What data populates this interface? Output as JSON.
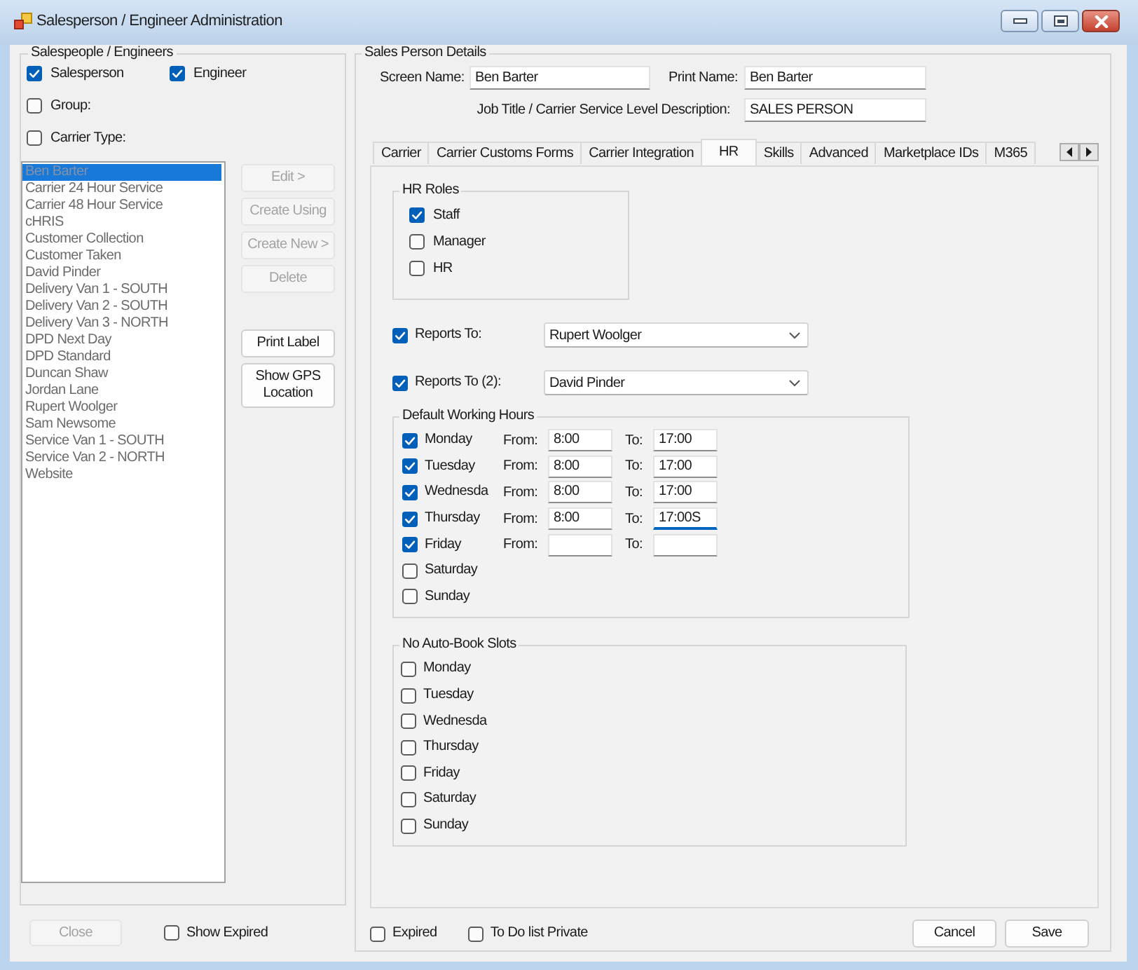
{
  "window": {
    "title": "Salesperson / Engineer Administration"
  },
  "people_panel": {
    "title": "Salespeople / Engineers",
    "filters": [
      {
        "label": "Salesperson",
        "checked": true
      },
      {
        "label": "Engineer",
        "checked": true
      },
      {
        "label": "Group:",
        "checked": false
      },
      {
        "label": "Carrier Type:",
        "checked": false
      }
    ],
    "list": [
      {
        "label": "Ben Barter",
        "selected": true
      },
      {
        "label": "Carrier 24 Hour Service",
        "selected": false
      },
      {
        "label": "Carrier 48 Hour Service",
        "selected": false
      },
      {
        "label": "cHRIS",
        "selected": false
      },
      {
        "label": "Customer Collection",
        "selected": false
      },
      {
        "label": "Customer Taken",
        "selected": false
      },
      {
        "label": "David Pinder",
        "selected": false
      },
      {
        "label": "Delivery Van 1 - SOUTH",
        "selected": false
      },
      {
        "label": "Delivery Van 2 - SOUTH",
        "selected": false
      },
      {
        "label": "Delivery Van 3 - NORTH",
        "selected": false
      },
      {
        "label": "DPD Next Day",
        "selected": false
      },
      {
        "label": "DPD Standard",
        "selected": false
      },
      {
        "label": "Duncan Shaw",
        "selected": false
      },
      {
        "label": "Jordan Lane",
        "selected": false
      },
      {
        "label": "Rupert Woolger",
        "selected": false
      },
      {
        "label": "Sam Newsome",
        "selected": false
      },
      {
        "label": "Service Van 1 - SOUTH",
        "selected": false
      },
      {
        "label": "Service Van 2 - NORTH",
        "selected": false
      },
      {
        "label": "Website",
        "selected": false
      }
    ],
    "actions": [
      {
        "label": "Edit >",
        "disabled": true
      },
      {
        "label": "Create Using",
        "disabled": true
      },
      {
        "label": "Create New >",
        "disabled": true
      },
      {
        "label": "Delete",
        "disabled": true
      },
      {
        "label": "Print Label",
        "disabled": false
      },
      {
        "label": "Show GPS Location",
        "disabled": false
      }
    ],
    "close_button": {
      "label": "Close",
      "disabled": true
    },
    "show_expired": {
      "label": "Show Expired",
      "checked": false
    }
  },
  "details": {
    "title": "Sales Person Details",
    "fields": [
      {
        "label": "Screen Name:",
        "value": "Ben Barter"
      },
      {
        "label": "Print Name:",
        "value": "Ben Barter"
      },
      {
        "label": "Job Title / Carrier Service Level Description:",
        "value": "SALES PERSON"
      }
    ],
    "tabs": [
      {
        "label": "Carrier",
        "selected": false
      },
      {
        "label": "Carrier Customs Forms",
        "selected": false
      },
      {
        "label": "Carrier Integration",
        "selected": false
      },
      {
        "label": "HR",
        "selected": true
      },
      {
        "label": "Skills",
        "selected": false
      },
      {
        "label": "Advanced",
        "selected": false
      },
      {
        "label": "Marketplace IDs",
        "selected": false
      },
      {
        "label": "M365",
        "selected": false
      }
    ],
    "hr": {
      "roles": {
        "title": "HR Roles",
        "items": [
          {
            "label": "Staff",
            "checked": true
          },
          {
            "label": "Manager",
            "checked": false
          },
          {
            "label": "HR",
            "checked": false
          }
        ]
      },
      "reports_to": [
        {
          "label": "Reports To:",
          "checked": true,
          "value": "Rupert Woolger"
        },
        {
          "label": "Reports To (2):",
          "checked": true,
          "value": "David Pinder"
        }
      ],
      "working_hours": {
        "title": "Default Working Hours",
        "days": [
          {
            "day": "Monday",
            "checked": true,
            "from": {
              "label": "From:",
              "value": "8:00",
              "focused": false
            },
            "to": {
              "label": "To:",
              "value": "17:00",
              "focused": false
            }
          },
          {
            "day": "Tuesday",
            "checked": true,
            "from": {
              "label": "From:",
              "value": "8:00",
              "focused": false
            },
            "to": {
              "label": "To:",
              "value": "17:00",
              "focused": false
            }
          },
          {
            "day": "Wednesda",
            "checked": true,
            "from": {
              "label": "From:",
              "value": "8:00",
              "focused": false
            },
            "to": {
              "label": "To:",
              "value": "17:00",
              "focused": false
            }
          },
          {
            "day": "Thursday",
            "checked": true,
            "from": {
              "label": "From:",
              "value": "8:00",
              "focused": false
            },
            "to": {
              "label": "To:",
              "value": "17:00S",
              "focused": true
            }
          },
          {
            "day": "Friday",
            "checked": true,
            "from": {
              "label": "From:",
              "focused": false
            },
            "to": {
              "label": "To:",
              "focused": false
            }
          },
          {
            "day": "Saturday",
            "checked": false
          },
          {
            "day": "Sunday",
            "checked": false
          }
        ]
      },
      "no_auto_book": {
        "title": "No Auto-Book Slots",
        "days": [
          {
            "day": "Monday",
            "checked": false
          },
          {
            "day": "Tuesday",
            "checked": false
          },
          {
            "day": "Wednesda",
            "checked": false
          },
          {
            "day": "Thursday",
            "checked": false
          },
          {
            "day": "Friday",
            "checked": false
          },
          {
            "day": "Saturday",
            "checked": false
          },
          {
            "day": "Sunday",
            "checked": false
          }
        ]
      }
    },
    "options": [
      {
        "label": "Expired",
        "checked": false
      },
      {
        "label": "To Do list Private",
        "checked": false
      }
    ],
    "buttons": [
      {
        "label": "Cancel"
      },
      {
        "label": "Save"
      }
    ]
  }
}
